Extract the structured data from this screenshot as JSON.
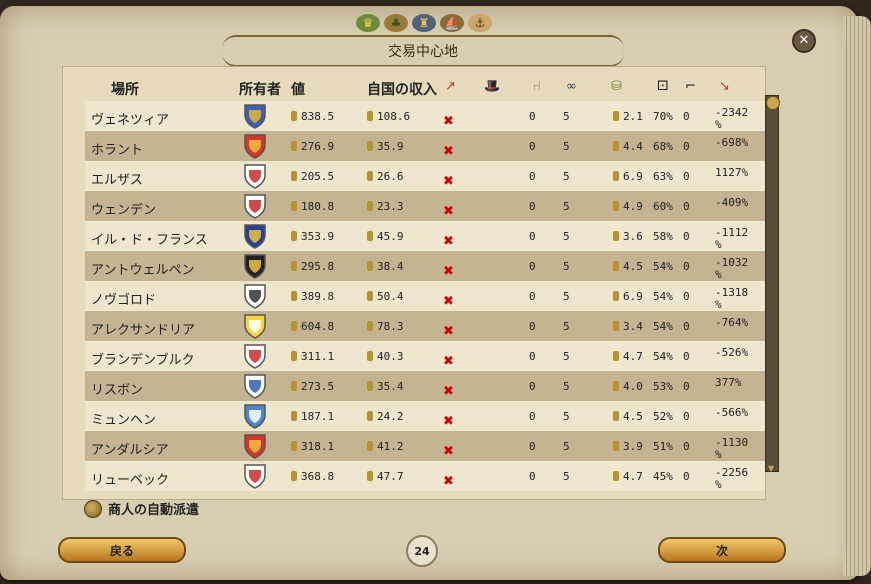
{
  "window": {
    "title": "交易中心地",
    "close_label": "✕"
  },
  "top_icons": [
    "crown-icon",
    "tree-icon",
    "castle-icon",
    "ship-icon",
    "ship2-icon"
  ],
  "headers": {
    "place": "場所",
    "owner": "所有者",
    "value": "値",
    "income": "自国の収入"
  },
  "header_icons": [
    "trade-arrow-icon",
    "hat-icon",
    "chair-icon",
    "coin-stack-icon",
    "bag-icon",
    "dice-icon",
    "pistol-icon",
    "sword-icon"
  ],
  "rows": [
    {
      "name": "ヴェネツィア",
      "value": "838.5",
      "income": "108.6",
      "c1": "0",
      "c2": "5",
      "c3": "2.1",
      "c4": "70%",
      "c5": "0",
      "c6": "-2342 %"
    },
    {
      "name": "ホラント",
      "value": "276.9",
      "income": "35.9",
      "c1": "0",
      "c2": "5",
      "c3": "4.4",
      "c4": "68%",
      "c5": "0",
      "c6": "-698%"
    },
    {
      "name": "エルザス",
      "value": "205.5",
      "income": "26.6",
      "c1": "0",
      "c2": "5",
      "c3": "6.9",
      "c4": "63%",
      "c5": "0",
      "c6": "1127%"
    },
    {
      "name": "ウェンデン",
      "value": "180.8",
      "income": "23.3",
      "c1": "0",
      "c2": "5",
      "c3": "4.9",
      "c4": "60%",
      "c5": "0",
      "c6": "-409%"
    },
    {
      "name": "イル・ド・フランス",
      "value": "353.9",
      "income": "45.9",
      "c1": "0",
      "c2": "5",
      "c3": "3.6",
      "c4": "58%",
      "c5": "0",
      "c6": "-1112 %"
    },
    {
      "name": "アントウェルペン",
      "value": "295.8",
      "income": "38.4",
      "c1": "0",
      "c2": "5",
      "c3": "4.5",
      "c4": "54%",
      "c5": "0",
      "c6": "-1032 %"
    },
    {
      "name": "ノヴゴロド",
      "value": "389.8",
      "income": "50.4",
      "c1": "0",
      "c2": "5",
      "c3": "6.9",
      "c4": "54%",
      "c5": "0",
      "c6": "-1318 %"
    },
    {
      "name": "アレクサンドリア",
      "value": "604.8",
      "income": "78.3",
      "c1": "0",
      "c2": "5",
      "c3": "3.4",
      "c4": "54%",
      "c5": "0",
      "c6": "-764%"
    },
    {
      "name": "ブランデンブルク",
      "value": "311.1",
      "income": "40.3",
      "c1": "0",
      "c2": "5",
      "c3": "4.7",
      "c4": "54%",
      "c5": "0",
      "c6": "-526%"
    },
    {
      "name": "リスボン",
      "value": "273.5",
      "income": "35.4",
      "c1": "0",
      "c2": "5",
      "c3": "4.0",
      "c4": "53%",
      "c5": "0",
      "c6": "377%"
    },
    {
      "name": "ミュンヘン",
      "value": "187.1",
      "income": "24.2",
      "c1": "0",
      "c2": "5",
      "c3": "4.5",
      "c4": "52%",
      "c5": "0",
      "c6": "-566%"
    },
    {
      "name": "アンダルシア",
      "value": "318.1",
      "income": "41.2",
      "c1": "0",
      "c2": "5",
      "c3": "3.9",
      "c4": "51%",
      "c5": "0",
      "c6": "-1130 %"
    },
    {
      "name": "リューベック",
      "value": "368.8",
      "income": "47.7",
      "c1": "0",
      "c2": "5",
      "c3": "4.7",
      "c4": "45%",
      "c5": "0",
      "c6": "-2256 %"
    }
  ],
  "shield_colors": [
    [
      "#3d5fb8",
      "#e0b92c"
    ],
    [
      "#d7342b",
      "#f0c040"
    ],
    [
      "#ffffff",
      "#c92a2a"
    ],
    [
      "#ffffff",
      "#c92a2a"
    ],
    [
      "#2a3f9a",
      "#e8c53a"
    ],
    [
      "#222222",
      "#f0c040"
    ],
    [
      "#ffffff",
      "#333333"
    ],
    [
      "#f5d53d",
      "#ffffff"
    ],
    [
      "#ffffff",
      "#c92a2a"
    ],
    [
      "#ffffff",
      "#2f5fb0"
    ],
    [
      "#4f86d0",
      "#ffffff"
    ],
    [
      "#d7342b",
      "#f0c040"
    ],
    [
      "#ffffff",
      "#c92a2a"
    ]
  ],
  "auto_dispatch_label": "商人の自動派遣",
  "back_button_label": "戻る",
  "next_button_label": "次",
  "page_number": "24"
}
